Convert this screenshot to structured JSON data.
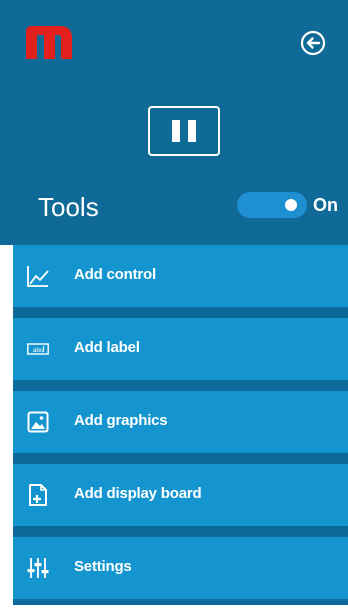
{
  "colors": {
    "header_bg": "#106a98",
    "menu_item_bg": "#1495cf",
    "menu_gap": "#0c6a9a",
    "toggle_on": "#1e8fd0",
    "logo_red": "#e3201b",
    "text": "#ffffff"
  },
  "header": {
    "logo_icon": "brand-m-logo",
    "back_icon": "arrow-left-circle-icon",
    "pause_icon": "pause-icon"
  },
  "tools": {
    "label": "Tools",
    "toggle_state": "On",
    "toggle_on": true
  },
  "menu": {
    "items": [
      {
        "label": "Add control",
        "icon": "line-chart-icon"
      },
      {
        "label": "Add label",
        "icon": "label-abc-icon"
      },
      {
        "label": "Add graphics",
        "icon": "image-icon"
      },
      {
        "label": "Add display board",
        "icon": "add-board-icon"
      },
      {
        "label": "Settings",
        "icon": "sliders-icon"
      }
    ]
  }
}
